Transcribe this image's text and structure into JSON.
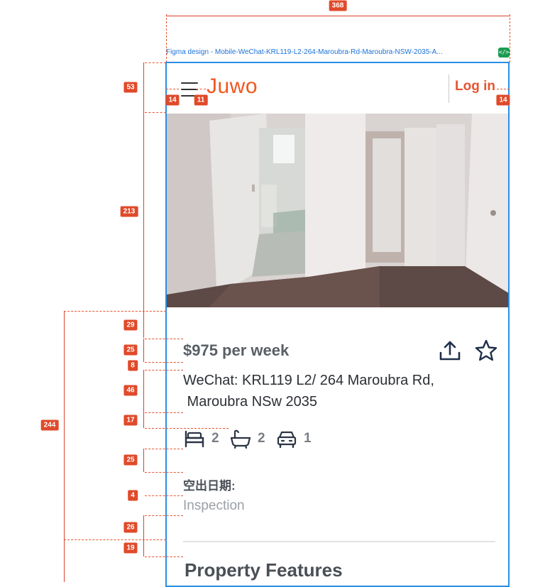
{
  "overlay": {
    "frame_label": "Figma design - Mobile-WeChat-KRL119-L2-264-Maroubra-Rd-Maroubra-NSW-2035-A...",
    "code_chip": "</>",
    "measure": {
      "width_top": "368",
      "header": "53",
      "photo": "213",
      "pad_top": "29",
      "price_h": "25",
      "gap_8": "8",
      "address_h": "46",
      "gap_17": "17",
      "gap_25": "25",
      "gap_4": "4",
      "gap_26": "26",
      "gap_19": "19",
      "section_244": "244",
      "left_pad": "14",
      "icon_gap": "11",
      "right_pad": "14"
    }
  },
  "header": {
    "logo": "Juwo",
    "login_label": "Log in",
    "menu_icon": "hamburger-icon"
  },
  "listing": {
    "price": "$975 per week",
    "address_line1": "WeChat: KRL119 L2/ 264 Maroubra Rd,",
    "address_line2": " Maroubra NSw 2035",
    "share_icon": "share-icon",
    "favorite_icon": "star-icon",
    "bedrooms": "2",
    "bathrooms": "2",
    "parking": "1",
    "available_label": "空出日期:",
    "inspection": "Inspection",
    "features_title": "Property Features"
  },
  "colors": {
    "accent": "#f2571f",
    "frame": "#2a8ee6",
    "measure": "#e04a2a"
  }
}
